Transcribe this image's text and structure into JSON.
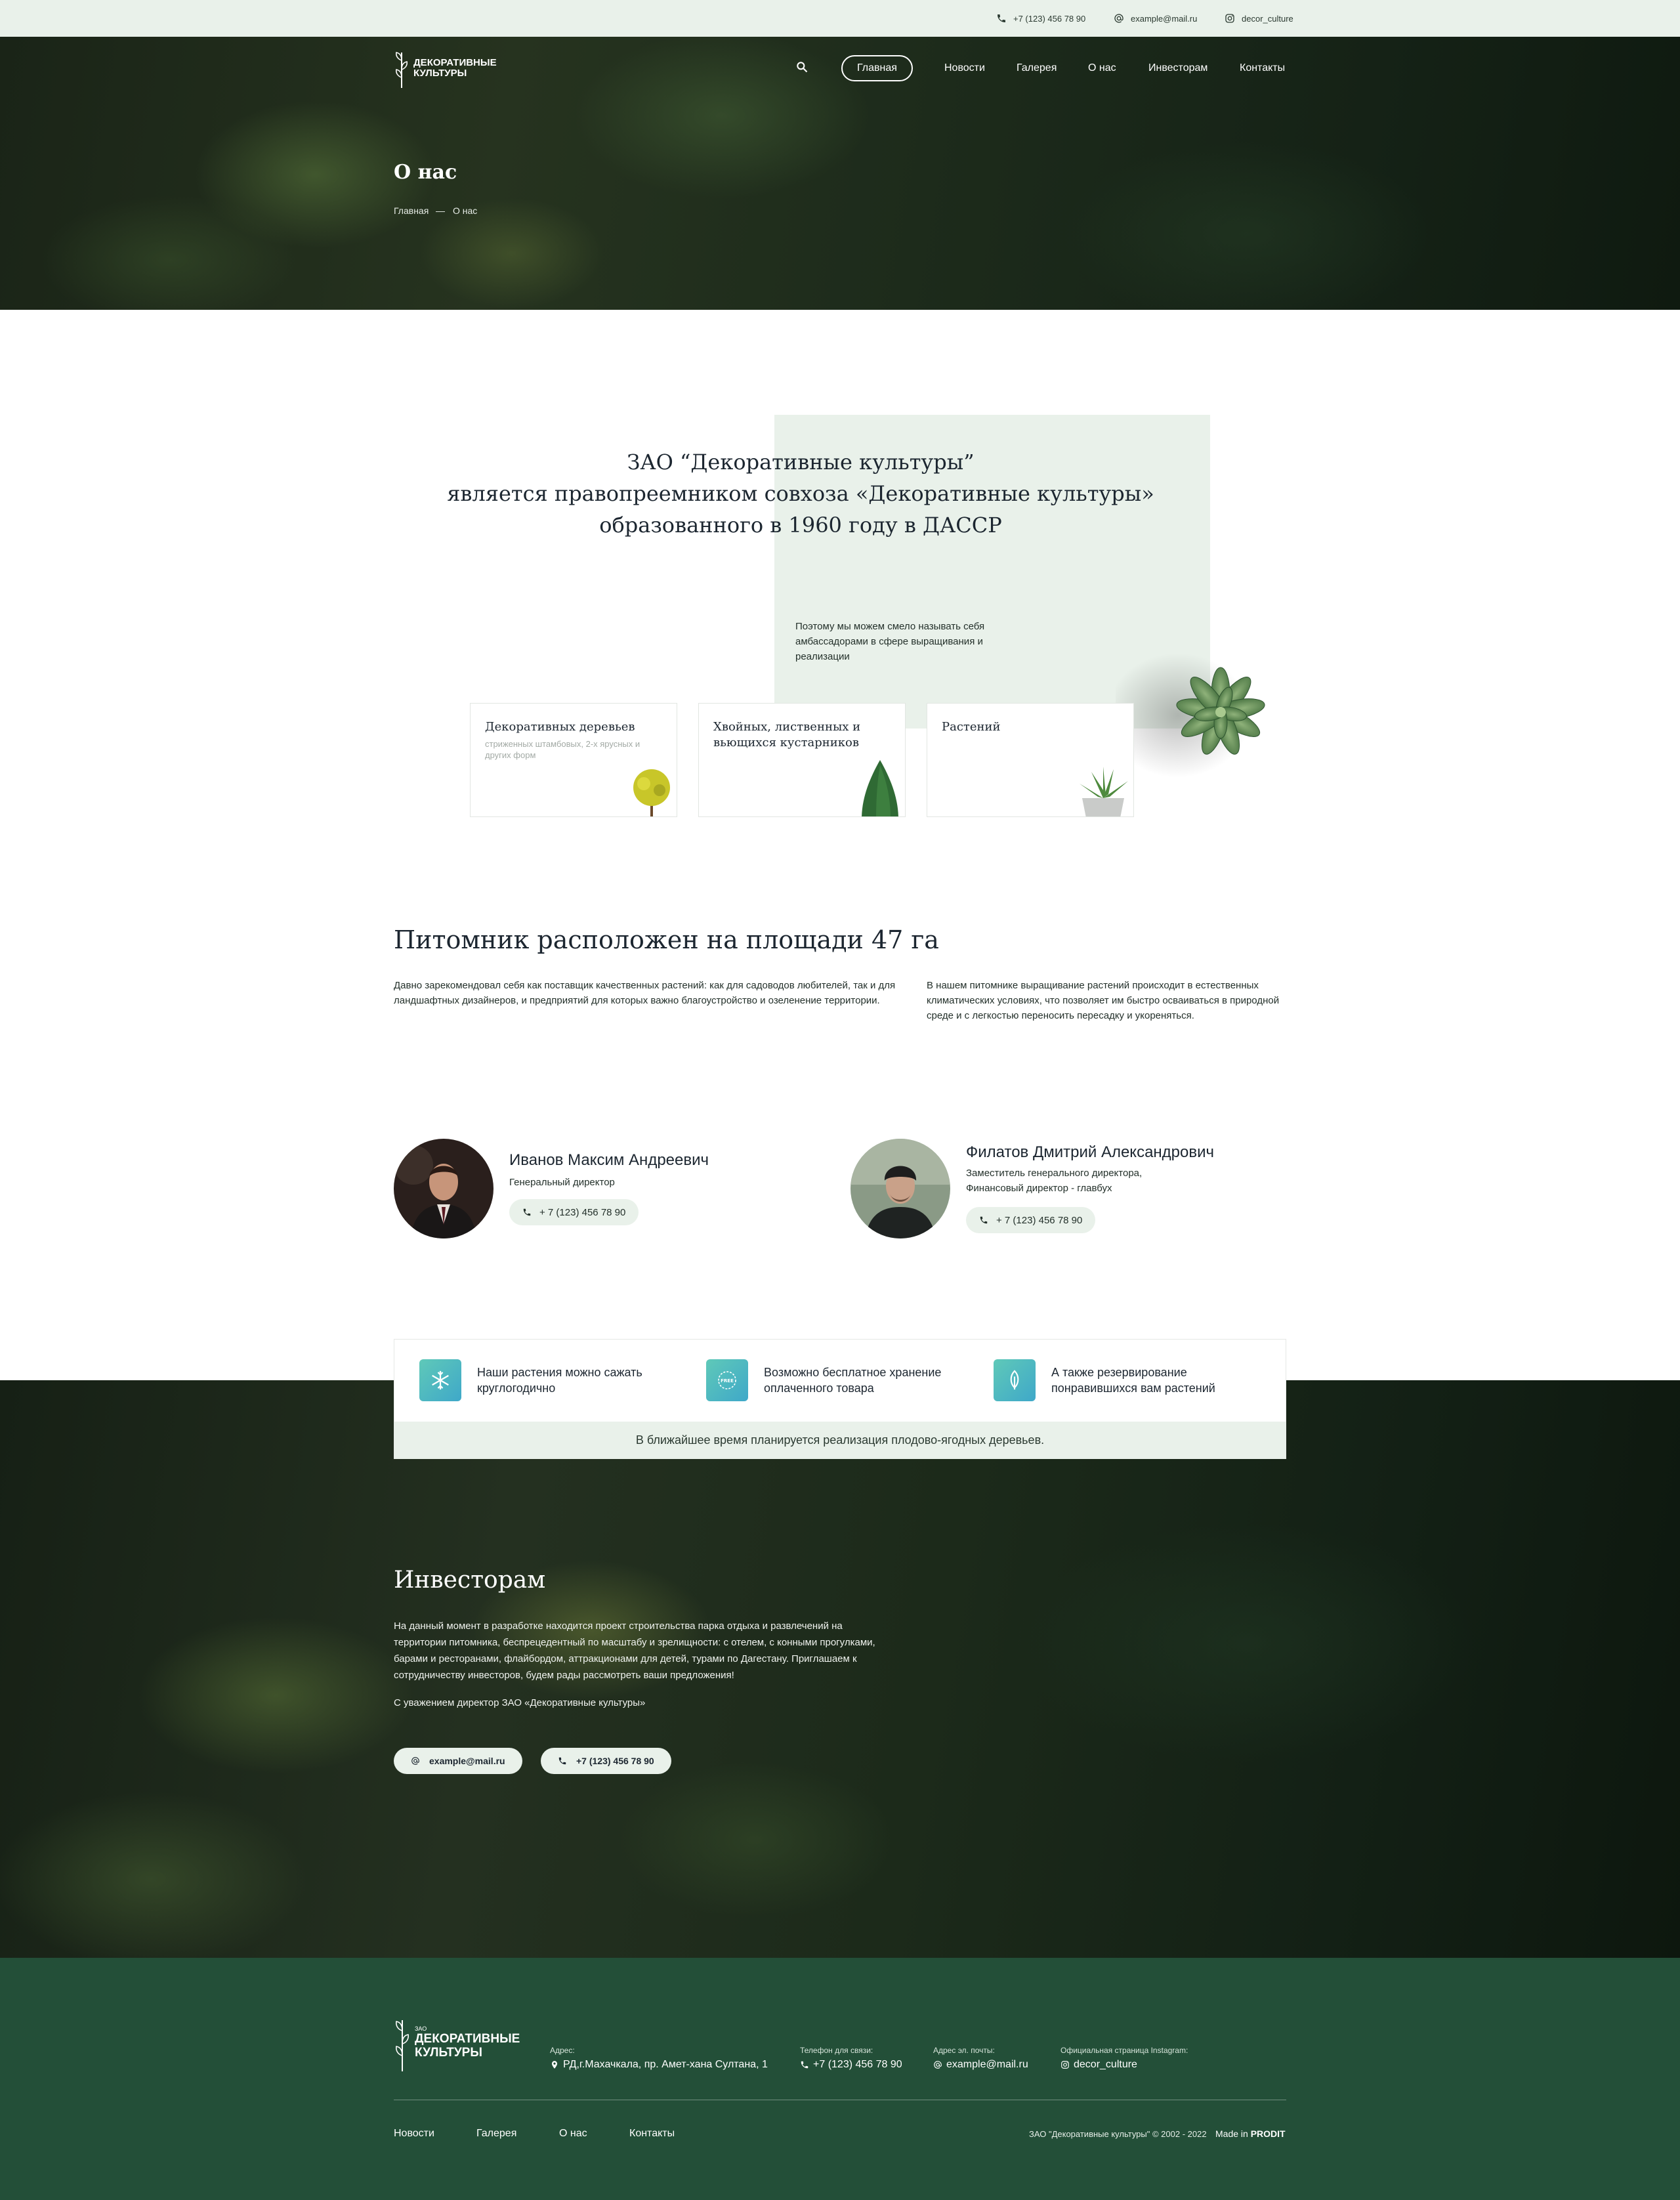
{
  "topbar": {
    "phone": "+7 (123) 456 78 90",
    "email": "example@mail.ru",
    "instagram": "decor_culture"
  },
  "header": {
    "logo_line1": "ДЕКОРАТИВНЫЕ",
    "logo_line2": "КУЛЬТУРЫ",
    "nav": [
      "Главная",
      "Новости",
      "Галерея",
      "О нас",
      "Инвесторам",
      "Контакты"
    ],
    "active_nav": "Главная"
  },
  "hero": {
    "title": "О нас",
    "breadcrumb": [
      "Главная",
      "О нас"
    ],
    "breadcrumb_separator": "—"
  },
  "intro": {
    "heading_lines": [
      "ЗАО “Декоративные культуры”",
      "является правопреемником совхоза «Декоративные культуры»",
      "образованного в 1960 году в ДАССР"
    ],
    "note": "Поэтому мы можем смело называть себя амбассадорами в сфере выращивания и реализации",
    "cards": [
      {
        "title": "Декоративных деревьев",
        "subtitle": "стриженных штамбовых, 2-х ярусных и других форм"
      },
      {
        "title": "Хвойных, лиственных и вьющихся кустарников",
        "subtitle": ""
      },
      {
        "title": "Растений",
        "subtitle": ""
      }
    ]
  },
  "nursery": {
    "title": "Питомник расположен на площади  47 га",
    "text_left": "Давно зарекомендовал себя как поставщик качественных растений: как для садоводов любителей, так и для ландшафтных дизайнеров, и предприятий для которых важно благоустройство и озеленение территории.",
    "text_right": "В нашем питомнике выращивание растений происходит в естественных климатических условиях, что позволяет им быстро осваиваться в природной среде и с легкостью переносить пересадку и укореняться."
  },
  "people": [
    {
      "name": "Иванов Максим Андреевич",
      "role": "Генеральный директор",
      "phone": "+ 7 (123) 456 78 90"
    },
    {
      "name": "Филатов Дмитрий Александрович",
      "role": "Заместитель генерального директора, Финансовый директор - главбух",
      "phone": "+ 7 (123) 456 78 90"
    }
  ],
  "features": {
    "items": [
      {
        "text": "Наши растения можно сажать круглогодично",
        "icon": "snowflake-icon"
      },
      {
        "text": "Возможно бесплатное хранение оплаченного товара",
        "icon": "free-badge-icon"
      },
      {
        "text": "А также резервирование понравившихся вам растений",
        "icon": "leaf-icon"
      }
    ],
    "badge_text": "FREE",
    "note": "В ближайшее время планируется реализация плодово-ягодных деревьев."
  },
  "investors": {
    "title": "Инвесторам",
    "text": "На данный момент в разработке находится проект строительства парка отдыха и развлечений на территории питомника, беспрецедентный по масштабу и зрелищности: с отелем, с конными прогулками, барами и ресторанами, флайбордом, аттракционами для детей, турами по Дагестану. Приглашаем к сотрудничеству инвесторов, будем рады рассмотреть ваши предложения!",
    "sign": "С уважением директор ЗАО «Декоративные культуры»",
    "email_button": "example@mail.ru",
    "phone_button": "+7 (123) 456 78 90"
  },
  "footer": {
    "logo_small": "ЗАО",
    "logo_line1": "ДЕКОРАТИВНЫЕ",
    "logo_line2": "КУЛЬТУРЫ",
    "address_label": "Адрес:",
    "address": "РД,г.Махачкала, пр. Амет-хана Султана, 1",
    "phone_label": "Телефон для связи:",
    "phone": "+7 (123) 456 78 90",
    "email_label": "Адрес эл. почты:",
    "email": "example@mail.ru",
    "instagram_label": "Официальная страница Instagram:",
    "instagram": "decor_culture",
    "nav": [
      "Новости",
      "Галерея",
      "О нас",
      "Контакты"
    ],
    "copyright": "ЗАО \"Декоративные культуры\" © 2002 - 2022",
    "made_in": "Made in",
    "made_by": "PRODIT"
  },
  "colors": {
    "accent_light": "#e9f1ea",
    "footer_bg": "#234f38",
    "feature_icon": "#4fb8c2"
  }
}
